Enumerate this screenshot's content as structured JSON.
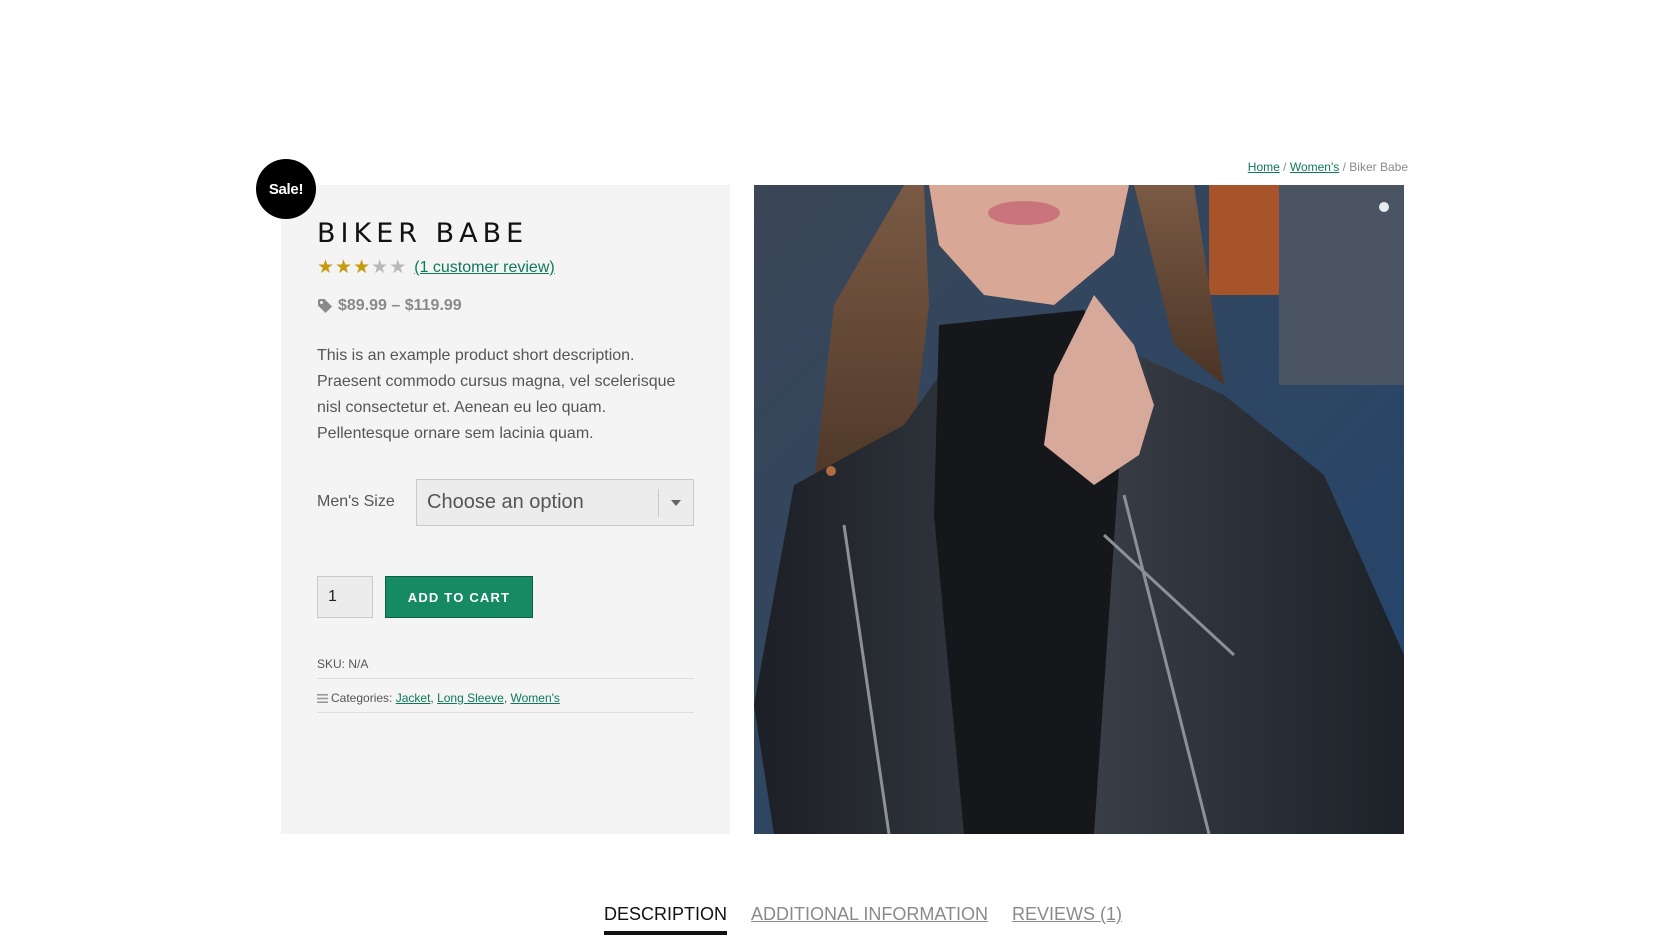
{
  "breadcrumb": {
    "home": "Home",
    "separator": "/",
    "category": "Women's",
    "current": "Biker Babe"
  },
  "sale_badge": "Sale!",
  "product": {
    "title": "BIKER BABE",
    "rating": 3,
    "rating_max": 5,
    "review_link": "(1 customer review)",
    "price": "$89.99 – $119.99",
    "short_description": "This is an example product short description. Praesent commodo cursus magna, vel scelerisque nisl consectetur et. Aenean eu leo quam. Pellentesque ornare sem lacinia quam.",
    "variation_label": "Men's Size",
    "variation_value": "Choose an option",
    "quantity": "1",
    "add_to_cart_label": "ADD TO CART",
    "sku": "SKU: N/A",
    "categories_label": "Categories:",
    "categories": [
      "Jacket",
      "Long Sleeve",
      "Women's"
    ]
  },
  "tabs": [
    {
      "label": "DESCRIPTION",
      "active": true
    },
    {
      "label": "ADDITIONAL INFORMATION",
      "active": false
    },
    {
      "label": "REVIEWS (1)",
      "active": false
    }
  ],
  "colors": {
    "accent": "#168a62",
    "link": "#0f7a5a",
    "star": "#c89a10",
    "panel": "#f4f4f4"
  }
}
